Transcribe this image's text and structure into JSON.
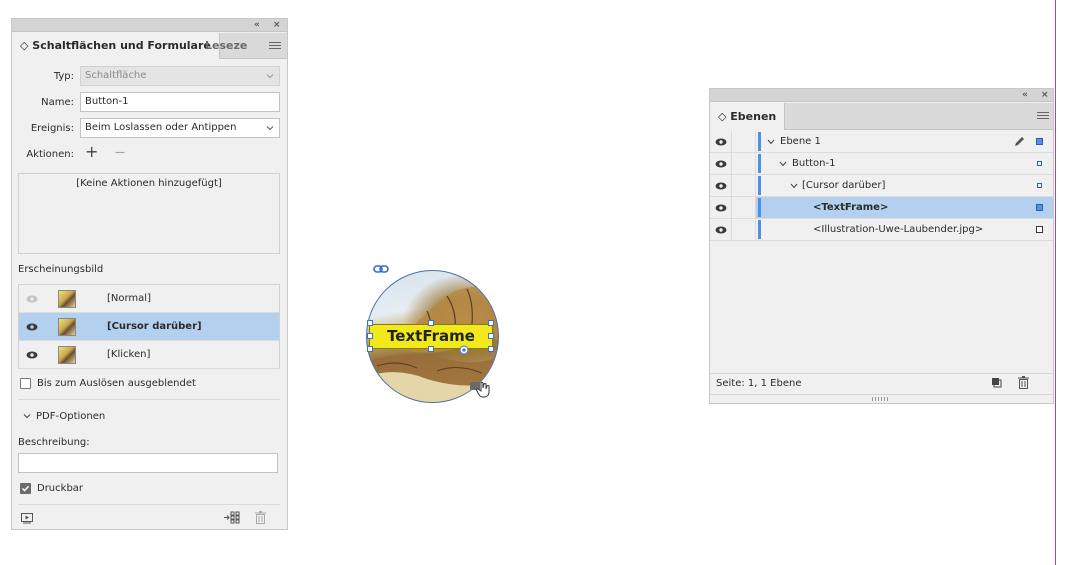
{
  "left_panel": {
    "collapse_glyph": "«",
    "close_glyph": "×",
    "tab_active_label": "◇ Schaltflächen und Formulare",
    "tab_inactive_label": "Lesezeic",
    "type_label": "Typ:",
    "type_value": "Schaltfläche",
    "name_label": "Name:",
    "name_value": "Button-1",
    "event_label": "Ereignis:",
    "event_value": "Beim Loslassen oder Antippen",
    "actions_label": "Aktionen:",
    "add_glyph": "+",
    "remove_glyph": "—",
    "no_actions_text": "[Keine Aktionen hinzugefügt]",
    "appearance_label": "Erscheinungsbild",
    "appearance_states": [
      {
        "label": "[Normal]"
      },
      {
        "label": "[Cursor darüber]"
      },
      {
        "label": "[Klicken]"
      }
    ],
    "hidden_label": "Bis zum Auslösen ausgeblendet",
    "pdf_options_label": "PDF-Optionen",
    "description_label": "Beschreibung:",
    "description_value": "",
    "printable_label": "Druckbar"
  },
  "canvas": {
    "frame_text": "TextFrame"
  },
  "layers_panel": {
    "collapse_glyph": "«",
    "close_glyph": "×",
    "tab_label": "◇ Ebenen",
    "rows": [
      {
        "label": "Ebene 1"
      },
      {
        "label": "Button-1"
      },
      {
        "label": "[Cursor darüber]"
      },
      {
        "label": "<TextFrame>"
      },
      {
        "label": "<Illustration-Uwe-Laubender.jpg>"
      }
    ],
    "status_text": "Seite: 1, 1 Ebene"
  },
  "colors": {
    "selection": "#b4d0ef",
    "layer_accent": "#4d8fe3",
    "frame_fill": "#f2e91b",
    "margin_guide": "#b040b0"
  }
}
